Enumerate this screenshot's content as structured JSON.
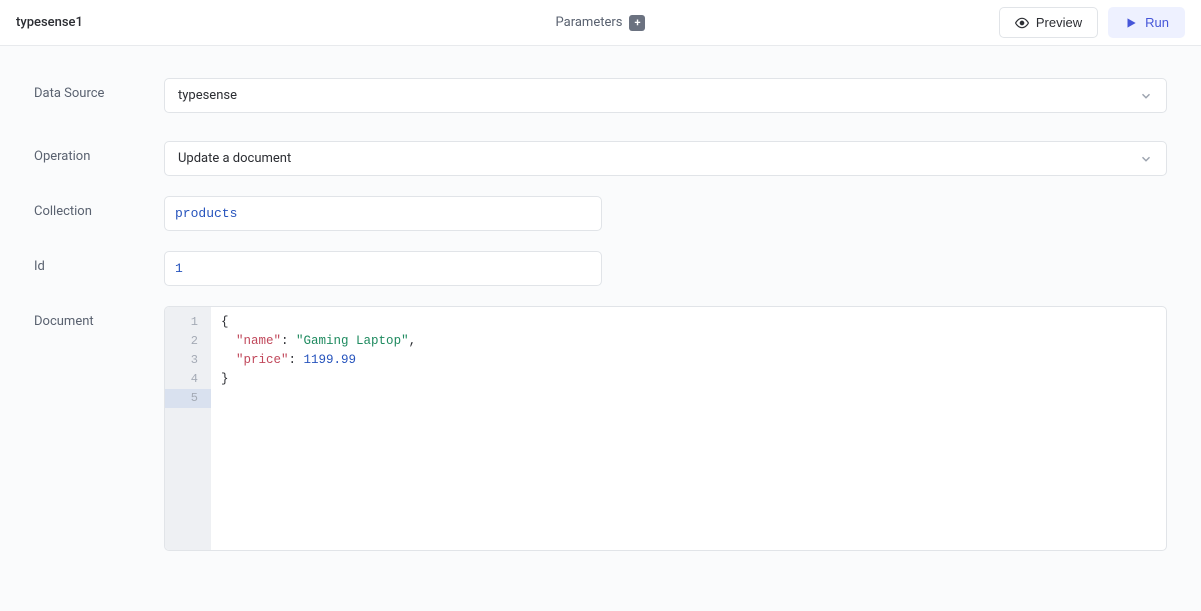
{
  "header": {
    "title": "typesense1",
    "parameters_label": "Parameters",
    "preview_label": "Preview",
    "run_label": "Run"
  },
  "form": {
    "data_source": {
      "label": "Data Source",
      "value": "typesense"
    },
    "operation": {
      "label": "Operation",
      "value": "Update a document"
    },
    "collection": {
      "label": "Collection",
      "value": "products"
    },
    "id": {
      "label": "Id",
      "value": "1"
    },
    "document": {
      "label": "Document",
      "lines": [
        "1",
        "2",
        "3",
        "4",
        "5"
      ],
      "code": {
        "l1": "{",
        "l2_key": "\"name\"",
        "l2_val": "\"Gaming Laptop\"",
        "l3_key": "\"price\"",
        "l3_val": "1199.99",
        "l4": "}"
      }
    }
  }
}
